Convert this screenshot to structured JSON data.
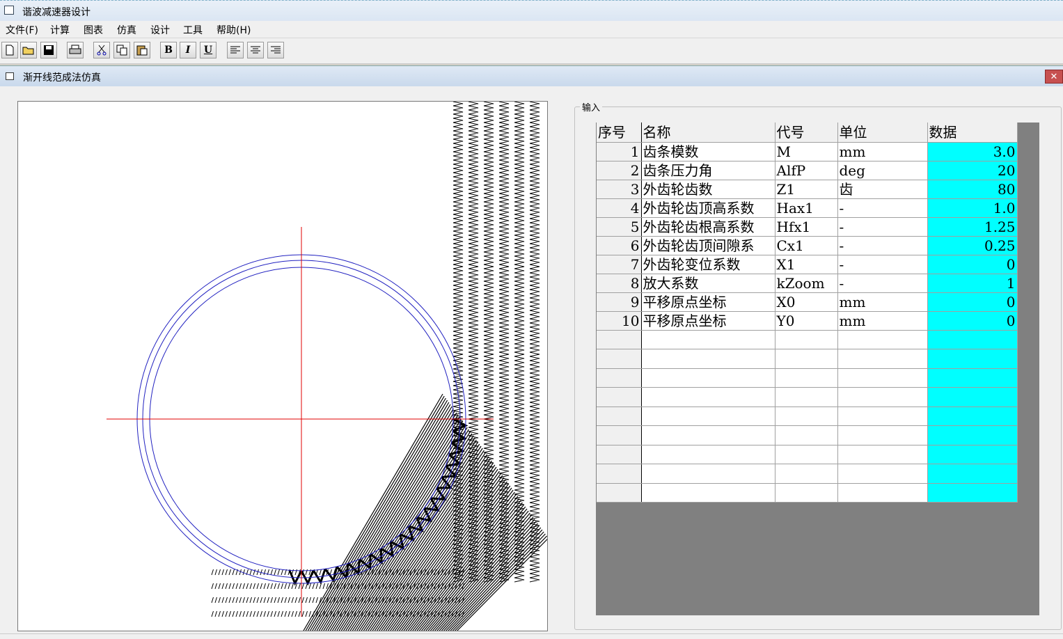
{
  "app": {
    "title": "谐波减速器设计"
  },
  "menu": [
    "文件(F)",
    "计算",
    "图表",
    "仿真",
    "设计",
    "工具",
    "帮助(H)"
  ],
  "toolbar": {
    "bold": "B",
    "italic": "I",
    "underline": "U"
  },
  "child": {
    "title": "渐开线范成法仿真",
    "close": "✕"
  },
  "input_group": {
    "label": "输入"
  },
  "grid": {
    "headers": [
      "序号",
      "名称",
      "代号",
      "单位",
      "数据"
    ],
    "rows": [
      {
        "no": "1",
        "name": "齿条模数",
        "code": "M",
        "unit": "mm",
        "value": "3.0"
      },
      {
        "no": "2",
        "name": "齿条压力角",
        "code": "AlfP",
        "unit": "deg",
        "value": "20"
      },
      {
        "no": "3",
        "name": "外齿轮齿数",
        "code": "Z1",
        "unit": "齿",
        "value": "80"
      },
      {
        "no": "4",
        "name": "外齿轮齿顶高系数",
        "code": "Hax1",
        "unit": "-",
        "value": "1.0"
      },
      {
        "no": "5",
        "name": "外齿轮齿根高系数",
        "code": "Hfx1",
        "unit": "-",
        "value": "1.25"
      },
      {
        "no": "6",
        "name": "外齿轮齿顶间隙系",
        "code": "Cx1",
        "unit": "-",
        "value": "0.25"
      },
      {
        "no": "7",
        "name": "外齿轮变位系数",
        "code": "X1",
        "unit": "-",
        "value": "0"
      },
      {
        "no": "8",
        "name": "放大系数",
        "code": "kZoom",
        "unit": "-",
        "value": "1"
      },
      {
        "no": "9",
        "name": "平移原点坐标",
        "code": "X0",
        "unit": "mm",
        "value": "0"
      },
      {
        "no": "10",
        "name": "平移原点坐标",
        "code": "Y0",
        "unit": "mm",
        "value": "0"
      }
    ],
    "empty_rows": 9
  },
  "colors": {
    "circle": "#2020c0",
    "axis": "#e00000",
    "teeth": "#000000",
    "value_bg": "#00ffff"
  }
}
